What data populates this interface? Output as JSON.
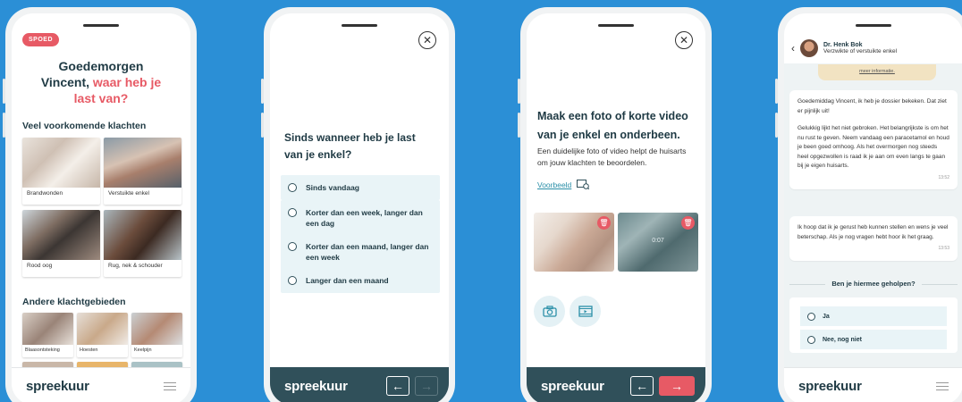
{
  "brand": {
    "logo": "spreekuur",
    "accent": "#e75a65",
    "dark": "#30505a",
    "background": "#2b8fd6"
  },
  "screen1": {
    "badge": "SPOED",
    "greeting_line1": "Goedemorgen",
    "greeting_name": "Vincent,",
    "greeting_accent1": "waar heb je",
    "greeting_accent2": "last van?",
    "common_title": "Veel voorkomende klachten",
    "common_items": [
      "Brandwonden",
      "Verstuikte enkel",
      "Rood oog",
      "Rug, nek & schouder"
    ],
    "other_title": "Andere klachtgebieden",
    "other_items": [
      "Blaasontsteking",
      "Hoesten",
      "Keelpijn"
    ]
  },
  "screen2": {
    "question": "Sinds wanneer heb je last van je enkel?",
    "options": [
      "Sinds vandaag",
      "Korter dan een week, langer dan een dag",
      "Korter dan een maand, langer dan een week",
      "Langer dan een maand"
    ]
  },
  "screen3": {
    "title": "Maak een foto of korte video van je enkel en onderbeen.",
    "body": "Een duidelijke foto of video helpt de huisarts om jouw klachten te beoordelen.",
    "example_link": "Voorbeeld",
    "video_duration": "0:07"
  },
  "screen4": {
    "doctor_name": "Dr. Henk Bok",
    "subject": "Verzwikte of verstuikte enkel",
    "notice_link": "meer informatie.",
    "message1_p1": "Goedemiddag Vincent, ik heb je dossier bekeken. Dat ziet er pijnlijk uit!",
    "message1_p2": "Gelukkig lijkt het niet gebroken. Het belangrijkste is om het nu rust te geven. Neem vandaag een paracetamol en houd je been goed omhoog. Als het overmorgen nog steeds heel opgezwollen is raad ik je aan om even langs te gaan bij je eigen huisarts.",
    "message1_time": "13:52",
    "message2": "Ik hoop dat ik je gerust heb kunnen stellen en wens je veel beterschap. Als je nog vragen hebt hoor ik het graag.",
    "message2_time": "13:53",
    "question": "Ben je hiermee geholpen?",
    "answers": [
      "Ja",
      "Nee, nog niet"
    ]
  },
  "nav": {
    "back_arrow": "←",
    "next_arrow": "→",
    "close": "✕"
  }
}
